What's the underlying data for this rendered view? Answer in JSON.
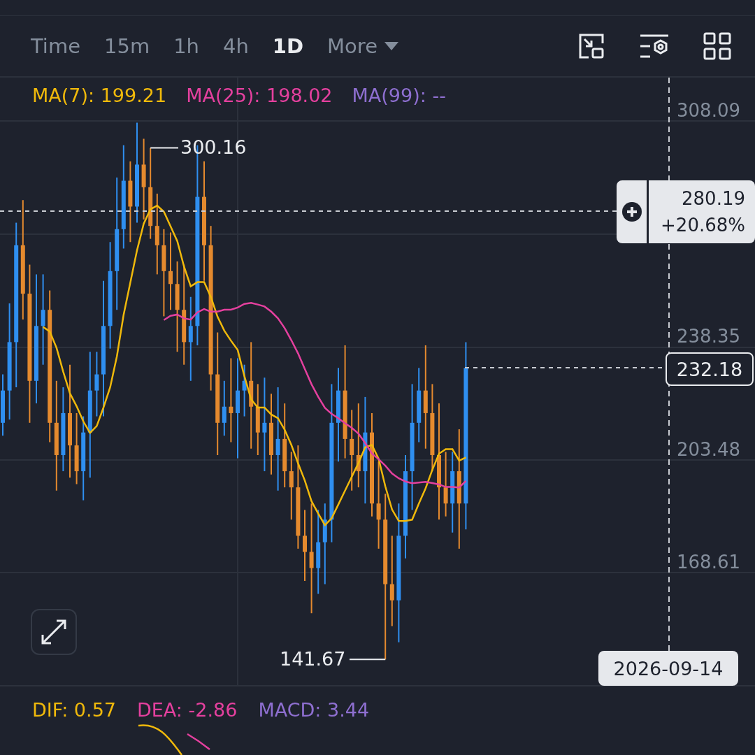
{
  "toolbar": {
    "intervals": [
      {
        "label": "Time",
        "selected": false
      },
      {
        "label": "15m",
        "selected": false
      },
      {
        "label": "1h",
        "selected": false
      },
      {
        "label": "4h",
        "selected": false
      },
      {
        "label": "1D",
        "selected": true
      }
    ],
    "more": {
      "label": "More"
    }
  },
  "indicators": [
    {
      "label": "MA(7): 199.21",
      "color": "#f0b90b"
    },
    {
      "label": "MA(25): 198.02",
      "color": "#e4409e"
    },
    {
      "label": "MA(99): --",
      "color": "#8e6fd0"
    }
  ],
  "price_axis": [
    "308.09",
    "238.35",
    "203.48",
    "168.61"
  ],
  "high_label": "300.16",
  "low_label": "141.67",
  "crosshair": {
    "price": "280.19",
    "change": "+20.68%"
  },
  "last_price": "232.18",
  "date_label": "2026-09-14",
  "macd": [
    {
      "label": "DIF: 0.57",
      "color": "#f0b90b"
    },
    {
      "label": "DEA: -2.86",
      "color": "#e4409e"
    },
    {
      "label": "MACD: 3.44",
      "color": "#8e6fd0"
    }
  ]
}
